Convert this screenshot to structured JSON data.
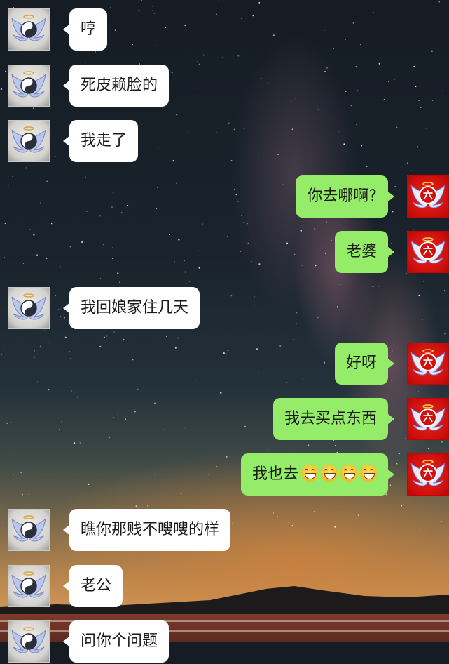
{
  "chat": {
    "messages": [
      {
        "side": "left",
        "text": "哼"
      },
      {
        "side": "left",
        "text": "死皮赖脸的"
      },
      {
        "side": "left",
        "text": "我走了"
      },
      {
        "side": "right",
        "text": "你去哪啊?"
      },
      {
        "side": "right",
        "text": "老婆"
      },
      {
        "side": "left",
        "text": "我回娘家住几天"
      },
      {
        "side": "right",
        "text": "好呀"
      },
      {
        "side": "right",
        "text": "我去买点东西"
      },
      {
        "side": "right",
        "text": "我也去",
        "emoji_count": 4,
        "emoji": "grinning-face-emoji"
      },
      {
        "side": "left",
        "text": "瞧你那贱不嗖嗖的样"
      },
      {
        "side": "left",
        "text": "老公"
      },
      {
        "side": "left",
        "text": "问你个问题"
      }
    ]
  },
  "avatars": {
    "left": {
      "icon": "winged-yin-yang-avatar-icon",
      "colors": [
        "#f3f1ee",
        "#2a2f3a"
      ]
    },
    "right": {
      "icon": "winged-liu-character-avatar-icon",
      "glyph": "六",
      "colors": [
        "#d0100d",
        "#ffffff"
      ]
    }
  },
  "colors": {
    "bubble_left": "#ffffff",
    "bubble_right": "#95ec69",
    "text": "#1b1b1b"
  }
}
